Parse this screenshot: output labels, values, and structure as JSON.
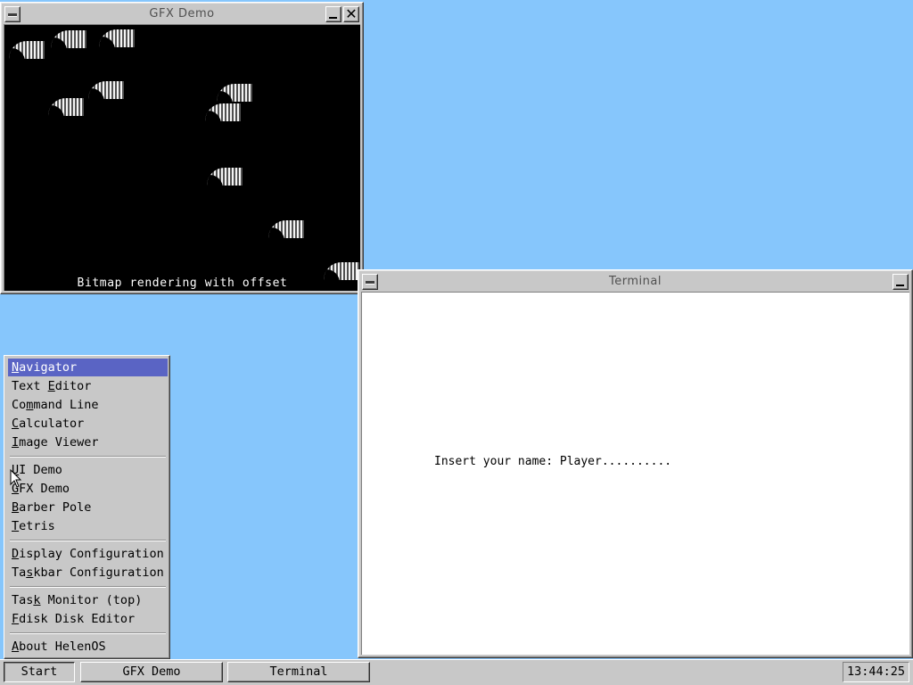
{
  "gfx_window": {
    "title": "GFX Demo",
    "caption": "Bitmap rendering with offset",
    "system_icon": "system-menu-icon",
    "minimize_icon": "minimize-icon",
    "close_icon": "close-icon",
    "close_glyph": "✕"
  },
  "terminal_window": {
    "title": "Terminal",
    "line": "Insert your name: Player..........",
    "system_icon": "system-menu-icon",
    "minimize_icon": "minimize-icon"
  },
  "start_menu": {
    "items": [
      {
        "pre": "",
        "key": "N",
        "post": "avigator"
      },
      {
        "pre": "Text ",
        "key": "E",
        "post": "ditor"
      },
      {
        "pre": "Co",
        "key": "m",
        "post": "mand Line"
      },
      {
        "pre": "",
        "key": "C",
        "post": "alculator"
      },
      {
        "pre": "",
        "key": "I",
        "post": "mage Viewer"
      },
      {
        "pre": "",
        "key": "U",
        "post": "I Demo"
      },
      {
        "pre": "",
        "key": "G",
        "post": "FX Demo"
      },
      {
        "pre": "",
        "key": "B",
        "post": "arber Pole"
      },
      {
        "pre": "",
        "key": "T",
        "post": "etris"
      },
      {
        "pre": "",
        "key": "D",
        "post": "isplay Configuration"
      },
      {
        "pre": "Ta",
        "key": "s",
        "post": "kbar Configuration"
      },
      {
        "pre": "Tas",
        "key": "k",
        "post": " Monitor (top)"
      },
      {
        "pre": "",
        "key": "F",
        "post": "disk Disk Editor"
      },
      {
        "pre": "",
        "key": "A",
        "post": "bout HelenOS"
      }
    ],
    "selected": "Navigator"
  },
  "taskbar": {
    "start_label": "Start",
    "windows": [
      "GFX Demo",
      "Terminal"
    ],
    "clock": "13:44:25"
  },
  "colors": {
    "desktop": "#86c6fc",
    "menu_highlight": "#5a64c4",
    "window_face": "#c8c8c8"
  }
}
